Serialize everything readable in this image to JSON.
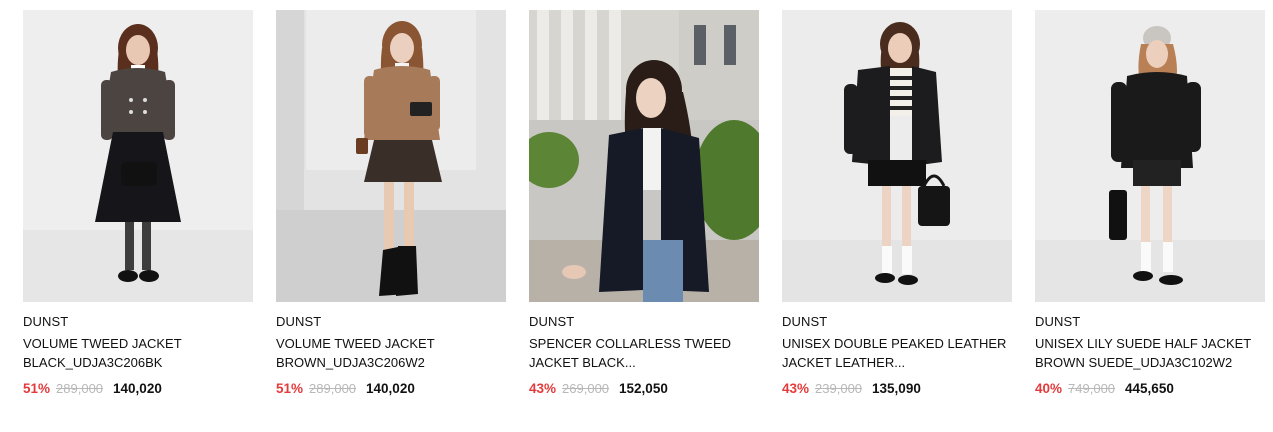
{
  "products": [
    {
      "image_icon": "model-black-tweed-jacket-image",
      "brand": "DUNST",
      "name_line1": "VOLUME TWEED JACKET",
      "name_line2": "BLACK_UDJA3C206BK",
      "discount": "51%",
      "original_price": "289,000",
      "sale_price": "140,020"
    },
    {
      "image_icon": "model-brown-tweed-jacket-image",
      "brand": "DUNST",
      "name_line1": "VOLUME TWEED JACKET",
      "name_line2": "BROWN_UDJA3C206W2",
      "discount": "51%",
      "original_price": "289,000",
      "sale_price": "140,020"
    },
    {
      "image_icon": "model-spencer-jacket-outdoor-image",
      "brand": "DUNST",
      "name_line1": "SPENCER COLLARLESS TWEED",
      "name_line2": "JACKET BLACK...",
      "discount": "43%",
      "original_price": "269,000",
      "sale_price": "152,050"
    },
    {
      "image_icon": "model-leather-jacket-image",
      "brand": "DUNST",
      "name_line1": "UNISEX DOUBLE PEAKED LEATHER",
      "name_line2": "JACKET LEATHER...",
      "discount": "43%",
      "original_price": "239,000",
      "sale_price": "135,090"
    },
    {
      "image_icon": "model-suede-jacket-image",
      "brand": "DUNST",
      "name_line1": "UNISEX LILY SUEDE HALF JACKET",
      "name_line2": "BROWN SUEDE_UDJA3C102W2",
      "discount": "40%",
      "original_price": "749,000",
      "sale_price": "445,650"
    }
  ],
  "colors": {
    "discount": "#e33b3b",
    "original_price": "#b8b8b8",
    "text": "#111111"
  }
}
